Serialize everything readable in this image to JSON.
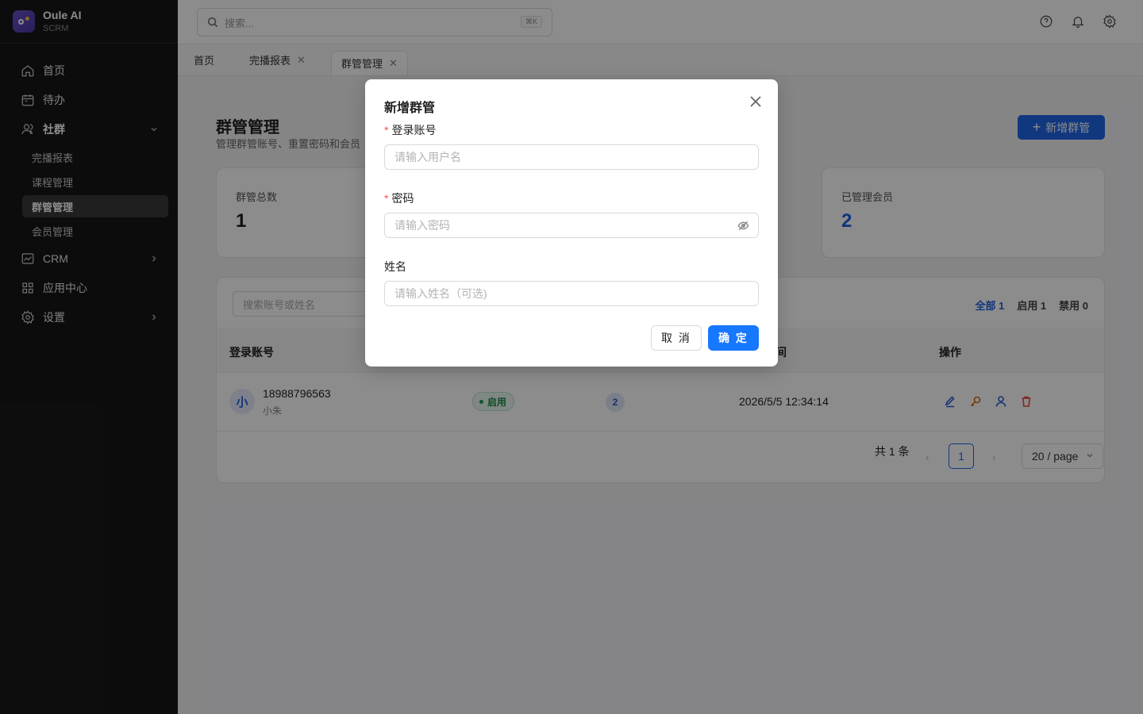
{
  "brand": {
    "name": "Oule AI",
    "sub": "SCRM"
  },
  "sidebar": {
    "items": [
      {
        "label": "首页",
        "icon": "home-icon"
      },
      {
        "label": "待办",
        "icon": "calendar-icon"
      },
      {
        "label": "社群",
        "icon": "users-icon"
      },
      {
        "label": "CRM",
        "icon": "chart-icon"
      },
      {
        "label": "应用中心",
        "icon": "grid-icon"
      },
      {
        "label": "设置",
        "icon": "gear-icon"
      }
    ],
    "sub_items": [
      "完播报表",
      "课程管理",
      "群管管理",
      "会员管理"
    ],
    "active_sub": "群管管理"
  },
  "topbar": {
    "search_placeholder": "搜索...",
    "shortcut": "⌘K"
  },
  "tabs": [
    {
      "label": "首页",
      "closable": false
    },
    {
      "label": "完播报表",
      "closable": true
    },
    {
      "label": "群管管理",
      "closable": true,
      "active": true
    }
  ],
  "page": {
    "title": "群管管理",
    "desc": "管理群管账号、重置密码和会员",
    "add_button": "新增群管"
  },
  "stats": [
    {
      "label": "群管总数",
      "value": "1"
    },
    {
      "label": "已管理会员",
      "value": "2"
    }
  ],
  "table": {
    "search_placeholder": "搜索账号或姓名",
    "filters": [
      "全部 1",
      "启用 1",
      "禁用 0"
    ],
    "headers": [
      "登录账号",
      "间",
      "操作"
    ],
    "rows": [
      {
        "avatar": "小",
        "account": "18988796563",
        "name": "小朱",
        "status": "启用",
        "members": "2",
        "time": "2026/5/5 12:34:14"
      }
    ],
    "pagination": {
      "total": "共 1 条",
      "page": "1",
      "page_size": "20 / page",
      "prev": "‹",
      "next": "›"
    }
  },
  "modal": {
    "title": "新增群管",
    "fields": [
      {
        "label": "登录账号",
        "required": true,
        "placeholder": "请输入用户名"
      },
      {
        "label": "密码",
        "required": true,
        "placeholder": "请输入密码"
      },
      {
        "label": "姓名",
        "required": false,
        "placeholder": "请输入姓名（可选)"
      }
    ],
    "required_mark": "*",
    "cancel": "取 消",
    "ok": "确 定"
  },
  "colors": {
    "primary": "#1677ff",
    "accent": "#1f5fe0",
    "sidebar": "#171717",
    "success": "#1d8a45",
    "danger": "#e5483f",
    "warning": "#d46b08"
  }
}
